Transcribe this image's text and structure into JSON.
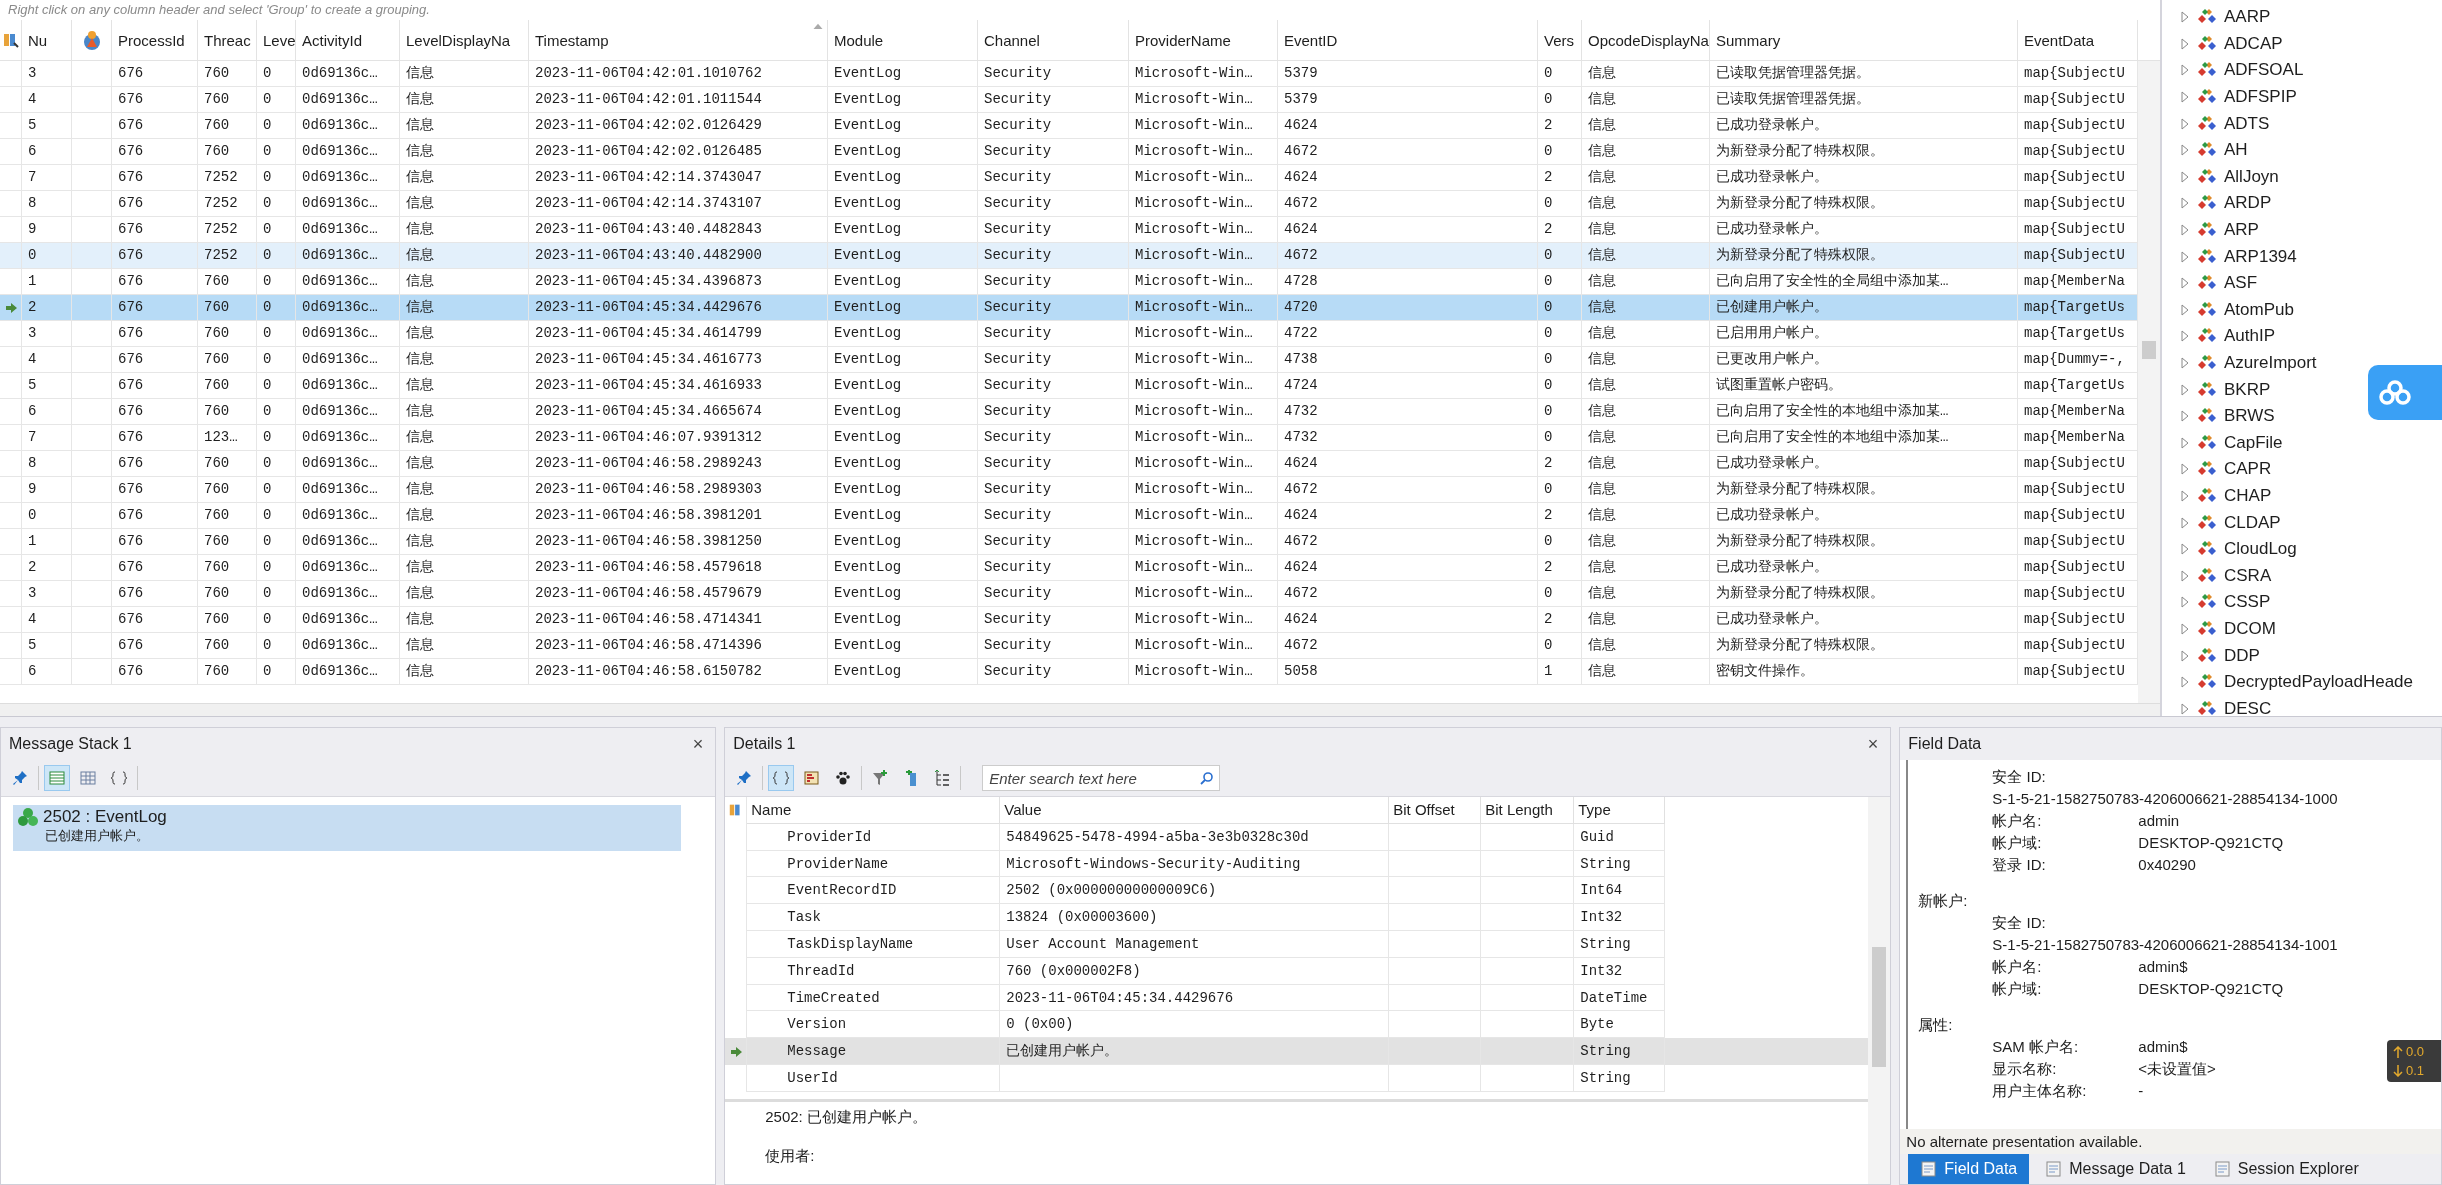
{
  "event_grid": {
    "hint": "Right click on any column header and select 'Group' to create a grouping.",
    "columns": [
      {
        "label": "Nu",
        "sorted": false
      },
      {
        "label": "ProcessId",
        "sorted": false
      },
      {
        "label": "Threac",
        "sorted": false
      },
      {
        "label": "Leve",
        "sorted": false
      },
      {
        "label": "ActivityId",
        "sorted": false
      },
      {
        "label": "LevelDisplayNa",
        "sorted": false
      },
      {
        "label": "Timestamp",
        "sorted": true
      },
      {
        "label": "Module",
        "sorted": false
      },
      {
        "label": "Channel",
        "sorted": false
      },
      {
        "label": "ProviderName",
        "sorted": false
      },
      {
        "label": "EventID",
        "sorted": false
      },
      {
        "label": "Vers",
        "sorted": false
      },
      {
        "label": "OpcodeDisplayNa",
        "sorted": false
      },
      {
        "label": "Summary",
        "sorted": false
      },
      {
        "label": "EventData",
        "sorted": false
      }
    ],
    "rows": [
      {
        "selected": false,
        "highlighted": false,
        "cells": [
          "3",
          "676",
          "760",
          "0",
          "0d69136c…",
          "信息",
          "2023-11-06T04:42:01.1010762",
          "EventLog",
          "Security",
          "Microsoft-Win…",
          "5379",
          "0",
          "信息",
          "已读取凭据管理器凭据。",
          "map{SubjectU"
        ]
      },
      {
        "selected": false,
        "highlighted": false,
        "cells": [
          "4",
          "676",
          "760",
          "0",
          "0d69136c…",
          "信息",
          "2023-11-06T04:42:01.1011544",
          "EventLog",
          "Security",
          "Microsoft-Win…",
          "5379",
          "0",
          "信息",
          "已读取凭据管理器凭据。",
          "map{SubjectU"
        ]
      },
      {
        "selected": false,
        "highlighted": false,
        "cells": [
          "5",
          "676",
          "760",
          "0",
          "0d69136c…",
          "信息",
          "2023-11-06T04:42:02.0126429",
          "EventLog",
          "Security",
          "Microsoft-Win…",
          "4624",
          "2",
          "信息",
          "已成功登录帐户。",
          "map{SubjectU"
        ]
      },
      {
        "selected": false,
        "highlighted": false,
        "cells": [
          "6",
          "676",
          "760",
          "0",
          "0d69136c…",
          "信息",
          "2023-11-06T04:42:02.0126485",
          "EventLog",
          "Security",
          "Microsoft-Win…",
          "4672",
          "0",
          "信息",
          "为新登录分配了特殊权限。",
          "map{SubjectU"
        ]
      },
      {
        "selected": false,
        "highlighted": false,
        "cells": [
          "7",
          "676",
          "7252",
          "0",
          "0d69136c…",
          "信息",
          "2023-11-06T04:42:14.3743047",
          "EventLog",
          "Security",
          "Microsoft-Win…",
          "4624",
          "2",
          "信息",
          "已成功登录帐户。",
          "map{SubjectU"
        ]
      },
      {
        "selected": false,
        "highlighted": false,
        "cells": [
          "8",
          "676",
          "7252",
          "0",
          "0d69136c…",
          "信息",
          "2023-11-06T04:42:14.3743107",
          "EventLog",
          "Security",
          "Microsoft-Win…",
          "4672",
          "0",
          "信息",
          "为新登录分配了特殊权限。",
          "map{SubjectU"
        ]
      },
      {
        "selected": false,
        "highlighted": false,
        "cells": [
          "9",
          "676",
          "7252",
          "0",
          "0d69136c…",
          "信息",
          "2023-11-06T04:43:40.4482843",
          "EventLog",
          "Security",
          "Microsoft-Win…",
          "4624",
          "2",
          "信息",
          "已成功登录帐户。",
          "map{SubjectU"
        ]
      },
      {
        "selected": false,
        "highlighted": true,
        "cells": [
          "0",
          "676",
          "7252",
          "0",
          "0d69136c…",
          "信息",
          "2023-11-06T04:43:40.4482900",
          "EventLog",
          "Security",
          "Microsoft-Win…",
          "4672",
          "0",
          "信息",
          "为新登录分配了特殊权限。",
          "map{SubjectU"
        ]
      },
      {
        "selected": false,
        "highlighted": false,
        "cells": [
          "1",
          "676",
          "760",
          "0",
          "0d69136c…",
          "信息",
          "2023-11-06T04:45:34.4396873",
          "EventLog",
          "Security",
          "Microsoft-Win…",
          "4728",
          "0",
          "信息",
          "已向启用了安全性的全局组中添加某…",
          "map{MemberNa"
        ]
      },
      {
        "selected": true,
        "highlighted": false,
        "cells": [
          "2",
          "676",
          "760",
          "0",
          "0d69136c…",
          "信息",
          "2023-11-06T04:45:34.4429676",
          "EventLog",
          "Security",
          "Microsoft-Win…",
          "4720",
          "0",
          "信息",
          "已创建用户帐户。",
          "map{TargetUs"
        ]
      },
      {
        "selected": false,
        "highlighted": false,
        "cells": [
          "3",
          "676",
          "760",
          "0",
          "0d69136c…",
          "信息",
          "2023-11-06T04:45:34.4614799",
          "EventLog",
          "Security",
          "Microsoft-Win…",
          "4722",
          "0",
          "信息",
          "已启用用户帐户。",
          "map{TargetUs"
        ]
      },
      {
        "selected": false,
        "highlighted": false,
        "cells": [
          "4",
          "676",
          "760",
          "0",
          "0d69136c…",
          "信息",
          "2023-11-06T04:45:34.4616773",
          "EventLog",
          "Security",
          "Microsoft-Win…",
          "4738",
          "0",
          "信息",
          "已更改用户帐户。",
          "map{Dummy=-,"
        ]
      },
      {
        "selected": false,
        "highlighted": false,
        "cells": [
          "5",
          "676",
          "760",
          "0",
          "0d69136c…",
          "信息",
          "2023-11-06T04:45:34.4616933",
          "EventLog",
          "Security",
          "Microsoft-Win…",
          "4724",
          "0",
          "信息",
          "试图重置帐户密码。",
          "map{TargetUs"
        ]
      },
      {
        "selected": false,
        "highlighted": false,
        "cells": [
          "6",
          "676",
          "760",
          "0",
          "0d69136c…",
          "信息",
          "2023-11-06T04:45:34.4665674",
          "EventLog",
          "Security",
          "Microsoft-Win…",
          "4732",
          "0",
          "信息",
          "已向启用了安全性的本地组中添加某…",
          "map{MemberNa"
        ]
      },
      {
        "selected": false,
        "highlighted": false,
        "cells": [
          "7",
          "676",
          "123…",
          "0",
          "0d69136c…",
          "信息",
          "2023-11-06T04:46:07.9391312",
          "EventLog",
          "Security",
          "Microsoft-Win…",
          "4732",
          "0",
          "信息",
          "已向启用了安全性的本地组中添加某…",
          "map{MemberNa"
        ]
      },
      {
        "selected": false,
        "highlighted": false,
        "cells": [
          "8",
          "676",
          "760",
          "0",
          "0d69136c…",
          "信息",
          "2023-11-06T04:46:58.2989243",
          "EventLog",
          "Security",
          "Microsoft-Win…",
          "4624",
          "2",
          "信息",
          "已成功登录帐户。",
          "map{SubjectU"
        ]
      },
      {
        "selected": false,
        "highlighted": false,
        "cells": [
          "9",
          "676",
          "760",
          "0",
          "0d69136c…",
          "信息",
          "2023-11-06T04:46:58.2989303",
          "EventLog",
          "Security",
          "Microsoft-Win…",
          "4672",
          "0",
          "信息",
          "为新登录分配了特殊权限。",
          "map{SubjectU"
        ]
      },
      {
        "selected": false,
        "highlighted": false,
        "cells": [
          "0",
          "676",
          "760",
          "0",
          "0d69136c…",
          "信息",
          "2023-11-06T04:46:58.3981201",
          "EventLog",
          "Security",
          "Microsoft-Win…",
          "4624",
          "2",
          "信息",
          "已成功登录帐户。",
          "map{SubjectU"
        ]
      },
      {
        "selected": false,
        "highlighted": false,
        "cells": [
          "1",
          "676",
          "760",
          "0",
          "0d69136c…",
          "信息",
          "2023-11-06T04:46:58.3981250",
          "EventLog",
          "Security",
          "Microsoft-Win…",
          "4672",
          "0",
          "信息",
          "为新登录分配了特殊权限。",
          "map{SubjectU"
        ]
      },
      {
        "selected": false,
        "highlighted": false,
        "cells": [
          "2",
          "676",
          "760",
          "0",
          "0d69136c…",
          "信息",
          "2023-11-06T04:46:58.4579618",
          "EventLog",
          "Security",
          "Microsoft-Win…",
          "4624",
          "2",
          "信息",
          "已成功登录帐户。",
          "map{SubjectU"
        ]
      },
      {
        "selected": false,
        "highlighted": false,
        "cells": [
          "3",
          "676",
          "760",
          "0",
          "0d69136c…",
          "信息",
          "2023-11-06T04:46:58.4579679",
          "EventLog",
          "Security",
          "Microsoft-Win…",
          "4672",
          "0",
          "信息",
          "为新登录分配了特殊权限。",
          "map{SubjectU"
        ]
      },
      {
        "selected": false,
        "highlighted": false,
        "cells": [
          "4",
          "676",
          "760",
          "0",
          "0d69136c…",
          "信息",
          "2023-11-06T04:46:58.4714341",
          "EventLog",
          "Security",
          "Microsoft-Win…",
          "4624",
          "2",
          "信息",
          "已成功登录帐户。",
          "map{SubjectU"
        ]
      },
      {
        "selected": false,
        "highlighted": false,
        "cells": [
          "5",
          "676",
          "760",
          "0",
          "0d69136c…",
          "信息",
          "2023-11-06T04:46:58.4714396",
          "EventLog",
          "Security",
          "Microsoft-Win…",
          "4672",
          "0",
          "信息",
          "为新登录分配了特殊权限。",
          "map{SubjectU"
        ]
      },
      {
        "selected": false,
        "highlighted": false,
        "cells": [
          "6",
          "676",
          "760",
          "0",
          "0d69136c…",
          "信息",
          "2023-11-06T04:46:58.6150782",
          "EventLog",
          "Security",
          "Microsoft-Win…",
          "5058",
          "1",
          "信息",
          "密钥文件操作。",
          "map{SubjectU"
        ]
      }
    ]
  },
  "protocol_tree": {
    "items": [
      {
        "label": "AARP",
        "expanded": false
      },
      {
        "label": "ADCAP",
        "expanded": false
      },
      {
        "label": "ADFSOAL",
        "expanded": false
      },
      {
        "label": "ADFSPIP",
        "expanded": false
      },
      {
        "label": "ADTS",
        "expanded": false
      },
      {
        "label": "AH",
        "expanded": false
      },
      {
        "label": "AllJoyn",
        "expanded": false
      },
      {
        "label": "ARDP",
        "expanded": false
      },
      {
        "label": "ARP",
        "expanded": false
      },
      {
        "label": "ARP1394",
        "expanded": false
      },
      {
        "label": "ASF",
        "expanded": false
      },
      {
        "label": "AtomPub",
        "expanded": false
      },
      {
        "label": "AuthIP",
        "expanded": false
      },
      {
        "label": "AzureImport",
        "expanded": false
      },
      {
        "label": "BKRP",
        "expanded": false
      },
      {
        "label": "BRWS",
        "expanded": false
      },
      {
        "label": "CapFile",
        "expanded": false
      },
      {
        "label": "CAPR",
        "expanded": false
      },
      {
        "label": "CHAP",
        "expanded": false
      },
      {
        "label": "CLDAP",
        "expanded": false
      },
      {
        "label": "CloudLog",
        "expanded": false
      },
      {
        "label": "CSRA",
        "expanded": false
      },
      {
        "label": "CSSP",
        "expanded": false
      },
      {
        "label": "DCOM",
        "expanded": false
      },
      {
        "label": "DDP",
        "expanded": false
      },
      {
        "label": "DecryptedPayloadHeade",
        "expanded": false
      },
      {
        "label": "DESC",
        "expanded": false
      }
    ]
  },
  "message_stack": {
    "title": "Message Stack 1",
    "close": "×",
    "toolbar": [
      {
        "kind": "pin",
        "active": false
      },
      {
        "kind": "rows",
        "active": true
      },
      {
        "kind": "grid",
        "active": false
      },
      {
        "kind": "braces",
        "active": false
      }
    ],
    "items": [
      {
        "title": "2502 : EventLog",
        "summary": "已创建用户帐户。",
        "selected": true
      }
    ]
  },
  "details": {
    "title": "Details 1",
    "close": "×",
    "toolbar": [
      {
        "kind": "pin",
        "active": false
      },
      {
        "kind": "braces",
        "active": true
      },
      {
        "kind": "chart",
        "active": false
      },
      {
        "kind": "paw",
        "active": false
      },
      {
        "kind": "filter",
        "active": false
      },
      {
        "kind": "addcol",
        "active": false
      },
      {
        "kind": "tree",
        "active": false
      }
    ],
    "search": {
      "placeholder": "Enter search text here"
    },
    "columns": [
      "Name",
      "Value",
      "Bit Offset",
      "Bit Length",
      "Type"
    ],
    "rows": [
      {
        "name": "ProviderId",
        "value": "54849625-5478-4994-a5ba-3e3b0328c30d",
        "type": "Guid",
        "selected": false
      },
      {
        "name": "ProviderName",
        "value": "Microsoft-Windows-Security-Auditing",
        "type": "String",
        "selected": false
      },
      {
        "name": "EventRecordID",
        "value": "2502 (0x00000000000009C6)",
        "type": "Int64",
        "selected": false
      },
      {
        "name": "Task",
        "value": "13824 (0x00003600)",
        "type": "Int32",
        "selected": false
      },
      {
        "name": "TaskDisplayName",
        "value": "User Account Management",
        "type": "String",
        "selected": false
      },
      {
        "name": "ThreadId",
        "value": "760 (0x000002F8)",
        "type": "Int32",
        "selected": false
      },
      {
        "name": "TimeCreated",
        "value": "2023-11-06T04:45:34.4429676",
        "type": "DateTime",
        "selected": false
      },
      {
        "name": "Version",
        "value": "0 (0x00)",
        "type": "Byte",
        "selected": false
      },
      {
        "name": "Message",
        "value": "已创建用户帐户。",
        "type": "String",
        "selected": true
      },
      {
        "name": "UserId",
        "value": "",
        "type": "String",
        "selected": false
      }
    ],
    "message_text": [
      "2502: 已创建用户帐户。",
      "使用者:"
    ]
  },
  "field_data": {
    "title": "Field Data",
    "sections": [
      {
        "fields": [
          {
            "label": "安全 ID:",
            "value": "S-1-5-21-1582750783-4206006621-28854134-1000",
            "kind": "stacked"
          },
          {
            "label": "帐户名:",
            "value": "admin",
            "kind": "inline"
          },
          {
            "label": "帐户域:",
            "value": "DESKTOP-Q921CTQ",
            "kind": "inline"
          },
          {
            "label": "登录 ID:",
            "value": "0x40290",
            "kind": "inline"
          }
        ]
      },
      {
        "heading": "新帐户:",
        "fields": [
          {
            "label": "安全 ID:",
            "value": "S-1-5-21-1582750783-4206006621-28854134-1001",
            "kind": "stacked"
          },
          {
            "label": "帐户名:",
            "value": "admin$",
            "kind": "inline"
          },
          {
            "label": "帐户域:",
            "value": "DESKTOP-Q921CTQ",
            "kind": "inline"
          }
        ]
      },
      {
        "heading": "属性:",
        "fields": [
          {
            "label": "SAM 帐户名:",
            "value": "admin$",
            "kind": "inline"
          },
          {
            "label": "显示名称:",
            "value": "<未设置值>",
            "kind": "inline"
          },
          {
            "label": "用户主体名称:",
            "value": "-",
            "kind": "inline"
          }
        ]
      }
    ],
    "status": "No alternate presentation available.",
    "tabs": [
      {
        "label": "Field Data",
        "selected": true
      },
      {
        "label": "Message Data 1",
        "selected": false
      },
      {
        "label": "Session Explorer",
        "selected": false
      }
    ]
  },
  "speed_meter": {
    "up": "0.0",
    "down": "0.1"
  }
}
